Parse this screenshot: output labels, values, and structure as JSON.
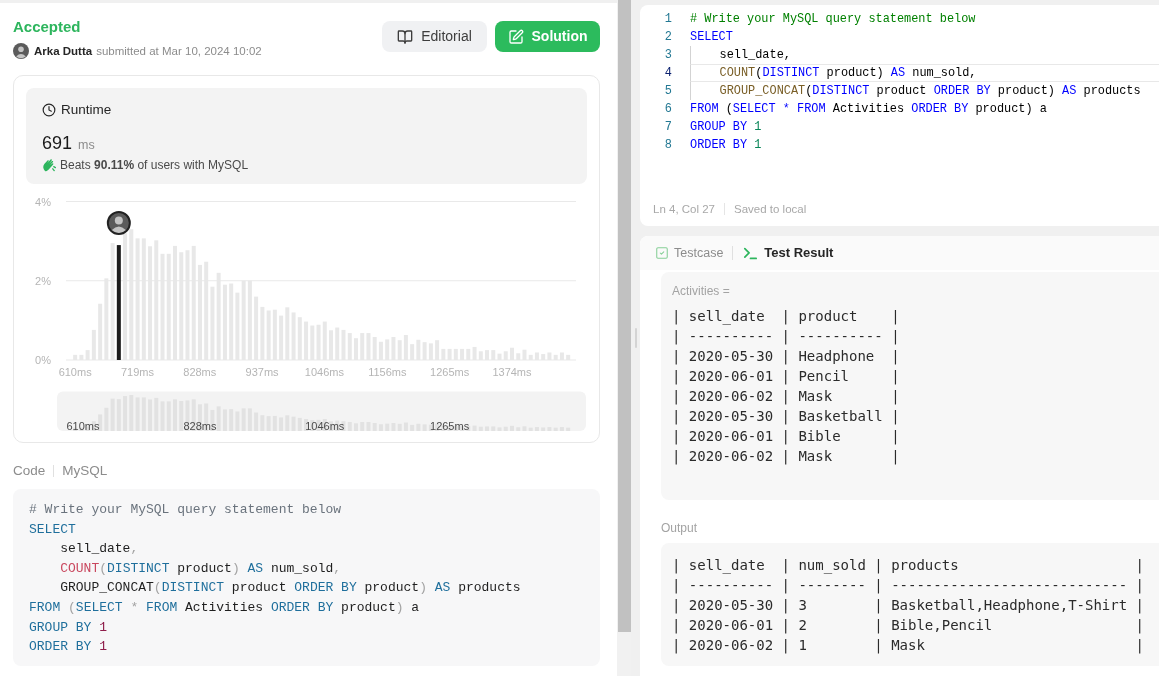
{
  "submission": {
    "status": "Accepted",
    "author": "Arka Dutta",
    "submitted": "submitted at Mar 10, 2024 10:02",
    "buttons": [
      {
        "label": "Editorial",
        "kind": "editorial"
      },
      {
        "label": "Solution",
        "kind": "solution"
      }
    ]
  },
  "runtime": {
    "title": "Runtime",
    "value": "691",
    "unit": "ms",
    "beats": "Beats **90.11%** of users with MySQL",
    "chart_data": {
      "type": "bar",
      "x": [
        610,
        620.9,
        631.8,
        642.7,
        653.7,
        664.6,
        675.5,
        686.4,
        697.3,
        708.2,
        719.2,
        730.1,
        741.0,
        751.9,
        762.8,
        773.7,
        784.6,
        795.6,
        806.5,
        817.4,
        828.3,
        839.2,
        850.1,
        861.0,
        872.0,
        882.9,
        893.8,
        904.7,
        915.6,
        926.5,
        937.5,
        948.4,
        959.3,
        970.2,
        981.1,
        992.0,
        1002.9,
        1013.9,
        1024.8,
        1035.7,
        1046.6,
        1057.5,
        1068.4,
        1079.3,
        1090.3,
        1101.2,
        1112.1,
        1123.0,
        1133.9,
        1144.8,
        1155.8,
        1166.7,
        1177.6,
        1188.5,
        1199.4,
        1210.3,
        1221.2,
        1232.2,
        1243.1,
        1254.0,
        1264.9,
        1275.8,
        1286.7,
        1297.6,
        1308.6,
        1319.5,
        1330.4,
        1341.3,
        1352.2,
        1363.1,
        1374.1,
        1385.0,
        1395.9,
        1406.8,
        1417.7,
        1428.6,
        1439.5,
        1450.5,
        1461.4,
        1472.3
      ],
      "series": [
        {
          "color": "#e8e8e8",
          "values": [
            0.13,
            0.13,
            0.25,
            0.76,
            1.42,
            2.06,
            2.95,
            null,
            3.2,
            3.3,
            3.07,
            3.07,
            2.87,
            3.02,
            2.68,
            2.68,
            2.88,
            2.72,
            2.77,
            2.88,
            2.4,
            2.48,
            1.85,
            2.2,
            1.9,
            1.93,
            1.7,
            2.0,
            2.0,
            1.6,
            1.34,
            1.25,
            1.27,
            1.12,
            1.33,
            1.2,
            1.08,
            0.97,
            0.87,
            0.89,
            0.97,
            0.75,
            0.82,
            0.76,
            0.68,
            0.55,
            0.68,
            0.68,
            0.58,
            0.46,
            0.52,
            0.58,
            0.5,
            0.63,
            0.4,
            0.51,
            0.45,
            0.42,
            0.5,
            0.28,
            0.28,
            0.28,
            0.28,
            0.28,
            0.33,
            0.22,
            0.25,
            0.25,
            0.16,
            0.22,
            0.31,
            0.17,
            0.26,
            0.13,
            0.19,
            0.15,
            0.19,
            0.13,
            0.19,
            0.13
          ]
        },
        {
          "color": "#1a1a1a",
          "values": [
            null,
            null,
            null,
            null,
            null,
            null,
            null,
            2.9,
            null,
            null,
            null,
            null,
            null,
            null,
            null,
            null,
            null,
            null,
            null,
            null,
            null,
            null,
            null,
            null,
            null,
            null,
            null,
            null,
            null,
            null,
            null,
            null,
            null,
            null,
            null,
            null,
            null,
            null,
            null,
            null,
            null,
            null,
            null,
            null,
            null,
            null,
            null,
            null,
            null,
            null,
            null,
            null,
            null,
            null,
            null,
            null,
            null,
            null,
            null,
            null,
            null,
            null,
            null,
            null,
            null,
            null,
            null,
            null,
            null,
            null,
            null,
            null,
            null,
            null,
            null,
            null,
            null,
            null,
            null,
            null
          ]
        }
      ],
      "stacked": true,
      "xlim": [
        594,
        1486
      ],
      "ylim": [
        0,
        4
      ],
      "xticks": [
        {
          "value": 610,
          "label": "610ms"
        },
        {
          "value": 719,
          "label": "719ms"
        },
        {
          "value": 828,
          "label": "828ms"
        },
        {
          "value": 937,
          "label": "937ms"
        },
        {
          "value": 1046,
          "label": "1046ms"
        },
        {
          "value": 1156,
          "label": "1156ms"
        },
        {
          "value": 1265,
          "label": "1265ms"
        },
        {
          "value": 1374,
          "label": "1374ms"
        }
      ],
      "yticks": [
        {
          "value": 0,
          "label": "0%"
        },
        {
          "value": 2,
          "label": "2%"
        },
        {
          "value": 4,
          "label": "4%"
        }
      ]
    },
    "overview_labels": [
      "610ms",
      "828ms",
      "1046ms",
      "1265ms"
    ]
  },
  "code": {
    "label": "Code",
    "language": "MySQL",
    "lines": [
      [
        {
          "text": "# Write your MySQL query statement below",
          "kind": "comment"
        }
      ],
      [
        {
          "text": "SELECT",
          "kind": "keyword"
        }
      ],
      [
        {
          "text": "    sell_date",
          "kind": "ident"
        },
        {
          "text": ",",
          "kind": "punct"
        }
      ],
      [
        {
          "text": "    COUNT",
          "kind": "function"
        },
        {
          "text": "(",
          "kind": "punct"
        },
        {
          "text": "DISTINCT",
          "kind": "keyword"
        },
        {
          "text": " product",
          "kind": "ident"
        },
        {
          "text": ")",
          "kind": "punct"
        },
        {
          "text": " AS",
          "kind": "keyword"
        },
        {
          "text": " num_sold",
          "kind": "ident"
        },
        {
          "text": ",",
          "kind": "punct"
        }
      ],
      [
        {
          "text": "    GROUP_CONCAT",
          "kind": "ident"
        },
        {
          "text": "(",
          "kind": "punct"
        },
        {
          "text": "DISTINCT",
          "kind": "keyword"
        },
        {
          "text": " product ",
          "kind": "ident"
        },
        {
          "text": "ORDER BY",
          "kind": "keyword"
        },
        {
          "text": " product",
          "kind": "ident"
        },
        {
          "text": ")",
          "kind": "punct"
        },
        {
          "text": " AS",
          "kind": "keyword"
        },
        {
          "text": " products",
          "kind": "ident"
        }
      ],
      [
        {
          "text": "FROM ",
          "kind": "keyword"
        },
        {
          "text": "(",
          "kind": "punct"
        },
        {
          "text": "SELECT ",
          "kind": "keyword"
        },
        {
          "text": "*",
          "kind": "operator"
        },
        {
          "text": " FROM",
          "kind": "keyword"
        },
        {
          "text": " Activities ",
          "kind": "ident"
        },
        {
          "text": "ORDER BY",
          "kind": "keyword"
        },
        {
          "text": " product",
          "kind": "ident"
        },
        {
          "text": ")",
          "kind": "punct"
        },
        {
          "text": " a",
          "kind": "ident"
        }
      ],
      [
        {
          "text": "GROUP BY ",
          "kind": "keyword"
        },
        {
          "text": "1",
          "kind": "number"
        }
      ],
      [
        {
          "text": "ORDER BY ",
          "kind": "keyword"
        },
        {
          "text": "1",
          "kind": "number"
        }
      ]
    ]
  },
  "editor": {
    "lines": [
      {
        "number": "1",
        "current": false,
        "tokens": [
          {
            "text": "# Write your MySQL query statement below",
            "kind": "comment"
          }
        ]
      },
      {
        "number": "2",
        "current": false,
        "tokens": [
          {
            "text": "SELECT",
            "kind": "keyword"
          }
        ]
      },
      {
        "number": "3",
        "current": false,
        "tokens": [
          {
            "text": "    sell_date",
            "kind": "ident"
          },
          {
            "text": ",",
            "kind": "punct"
          }
        ]
      },
      {
        "number": "4",
        "current": true,
        "tokens": [
          {
            "text": "    COUNT",
            "kind": "function"
          },
          {
            "text": "(",
            "kind": "punct"
          },
          {
            "text": "DISTINCT",
            "kind": "keyword"
          },
          {
            "text": " product",
            "kind": "ident"
          },
          {
            "text": ")",
            "kind": "punct"
          },
          {
            "text": " AS",
            "kind": "keyword"
          },
          {
            "text": " num_sold",
            "kind": "ident"
          },
          {
            "text": ",",
            "kind": "punct"
          }
        ]
      },
      {
        "number": "5",
        "current": false,
        "tokens": [
          {
            "text": "    GROUP_CONCAT",
            "kind": "function"
          },
          {
            "text": "(",
            "kind": "punct"
          },
          {
            "text": "DISTINCT",
            "kind": "keyword"
          },
          {
            "text": " product ",
            "kind": "ident"
          },
          {
            "text": "ORDER BY",
            "kind": "keyword"
          },
          {
            "text": " product",
            "kind": "ident"
          },
          {
            "text": ")",
            "kind": "punct"
          },
          {
            "text": " AS",
            "kind": "keyword"
          },
          {
            "text": " products",
            "kind": "ident"
          }
        ]
      },
      {
        "number": "6",
        "current": false,
        "tokens": [
          {
            "text": "FROM ",
            "kind": "keyword"
          },
          {
            "text": "(",
            "kind": "punct"
          },
          {
            "text": "SELECT ",
            "kind": "keyword"
          },
          {
            "text": "*",
            "kind": "operator"
          },
          {
            "text": " FROM",
            "kind": "keyword"
          },
          {
            "text": " Activities ",
            "kind": "ident"
          },
          {
            "text": "ORDER BY",
            "kind": "keyword"
          },
          {
            "text": " product",
            "kind": "ident"
          },
          {
            "text": ")",
            "kind": "punct"
          },
          {
            "text": " a",
            "kind": "ident"
          }
        ]
      },
      {
        "number": "7",
        "current": false,
        "tokens": [
          {
            "text": "GROUP BY ",
            "kind": "keyword"
          },
          {
            "text": "1",
            "kind": "number"
          }
        ]
      },
      {
        "number": "8",
        "current": false,
        "tokens": [
          {
            "text": "ORDER BY ",
            "kind": "keyword"
          },
          {
            "text": "1",
            "kind": "number"
          }
        ]
      }
    ],
    "position": "Ln 4, Col 27",
    "save_status": "Saved to local"
  },
  "console": {
    "tabs": [
      {
        "label": "Testcase",
        "kind": "testcase",
        "selected": false
      },
      {
        "label": "Test Result",
        "kind": "result",
        "selected": true
      }
    ],
    "input": {
      "label": "Activities =",
      "lines": [
        "| sell_date  | product    |",
        "| ---------- | ---------- |",
        "| 2020-05-30 | Headphone  |",
        "| 2020-06-01 | Pencil     |",
        "| 2020-06-02 | Mask       |",
        "| 2020-05-30 | Basketball |",
        "| 2020-06-01 | Bible      |",
        "| 2020-06-02 | Mask       |"
      ]
    },
    "output": {
      "label": "Output",
      "lines": [
        "| sell_date  | num_sold | products                     |",
        "| ---------- | -------- | ---------------------------- |",
        "| 2020-05-30 | 3        | Basketball,Headphone,T-Shirt |",
        "| 2020-06-01 | 2        | Bible,Pencil                 |",
        "| 2020-06-02 | 1        | Mask                         |"
      ]
    }
  }
}
